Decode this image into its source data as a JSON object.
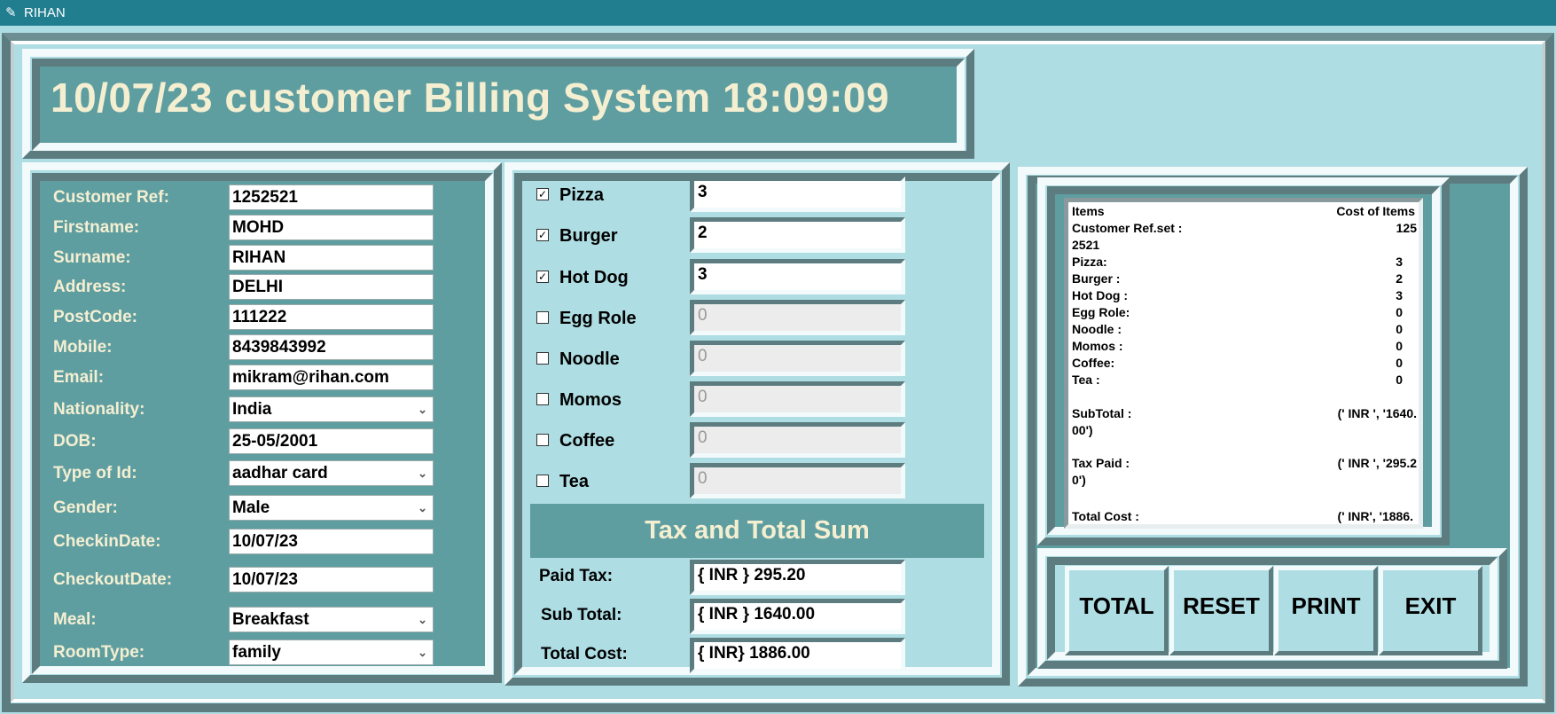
{
  "window": {
    "title": "RIHAN",
    "icon": "feather-icon"
  },
  "header": {
    "date": "10/07/23",
    "title": "customer Billing System",
    "time": "18:09:09"
  },
  "customer": {
    "fields": [
      {
        "label": "Customer Ref:",
        "value": "1252521",
        "type": "entry"
      },
      {
        "label": "Firstname:",
        "value": "MOHD",
        "type": "entry"
      },
      {
        "label": "Surname:",
        "value": "RIHAN",
        "type": "entry"
      },
      {
        "label": "Address:",
        "value": "DELHI",
        "type": "entry"
      },
      {
        "label": "PostCode:",
        "value": "111222",
        "type": "entry"
      },
      {
        "label": "Mobile:",
        "value": "8439843992",
        "type": "entry"
      },
      {
        "label": "Email:",
        "value": "mikram@rihan.com",
        "type": "entry"
      },
      {
        "label": "Nationality:",
        "value": "India",
        "type": "combo"
      },
      {
        "label": "DOB:",
        "value": "25-05/2001",
        "type": "entry"
      },
      {
        "label": "Type of Id:",
        "value": "aadhar card",
        "type": "combo"
      },
      {
        "label": "Gender:",
        "value": "Male",
        "type": "combo"
      },
      {
        "label": "CheckinDate:",
        "value": "10/07/23",
        "type": "entry"
      },
      {
        "label": "CheckoutDate:",
        "value": "10/07/23",
        "type": "entry"
      },
      {
        "label": "Meal:",
        "value": "Breakfast",
        "type": "combo"
      },
      {
        "label": "RoomType:",
        "value": "family",
        "type": "combo"
      }
    ]
  },
  "menu": {
    "items": [
      {
        "label": "Pizza",
        "checked": true,
        "qty": "3"
      },
      {
        "label": "Burger",
        "checked": true,
        "qty": "2"
      },
      {
        "label": "Hot Dog",
        "checked": true,
        "qty": "3"
      },
      {
        "label": "Egg Role",
        "checked": false,
        "qty": "0"
      },
      {
        "label": "Noodle",
        "checked": false,
        "qty": "0"
      },
      {
        "label": "Momos",
        "checked": false,
        "qty": "0"
      },
      {
        "label": "Coffee",
        "checked": false,
        "qty": "0"
      },
      {
        "label": "Tea",
        "checked": false,
        "qty": "0"
      }
    ],
    "check_mark": "✓"
  },
  "totals": {
    "heading": "Tax and Total Sum",
    "paid_tax_label": "Paid Tax:",
    "paid_tax_value": "{ INR } 295.20",
    "sub_total_label": "Sub Total:",
    "sub_total_value": "{ INR } 1640.00",
    "total_cost_label": "Total Cost:",
    "total_cost_value": "{ INR} 1886.00"
  },
  "receipt": {
    "items_header": "Items",
    "cost_header": "Cost of Items",
    "ref_label": "Customer Ref.set :",
    "ref_value": "125",
    "ref_wrap": "2521",
    "lines": [
      {
        "label": "Pizza:",
        "value": "3"
      },
      {
        "label": "Burger :",
        "value": "2"
      },
      {
        "label": "Hot Dog :",
        "value": "3"
      },
      {
        "label": "Egg Role:",
        "value": "0"
      },
      {
        "label": "Noodle :",
        "value": "0"
      },
      {
        "label": "Momos :",
        "value": "0"
      },
      {
        "label": "Coffee:",
        "value": "0"
      },
      {
        "label": "Tea :",
        "value": "0"
      }
    ],
    "subtotal_label": "SubTotal :",
    "subtotal_value": "(' INR ', '1640.",
    "subtotal_wrap": "00')",
    "tax_label": "Tax Paid :",
    "tax_value": "(' INR ', '295.2",
    "tax_wrap": "0')",
    "total_label": "Total Cost :",
    "total_value": "(' INR', '1886."
  },
  "buttons": {
    "total": "TOTAL",
    "reset": "RESET",
    "print": "PRINT",
    "exit": "EXIT"
  },
  "colors": {
    "titlebar": "#217e8f",
    "panel": "#5f9ea0",
    "background": "#aedde3",
    "label_text": "#f5efd2"
  }
}
